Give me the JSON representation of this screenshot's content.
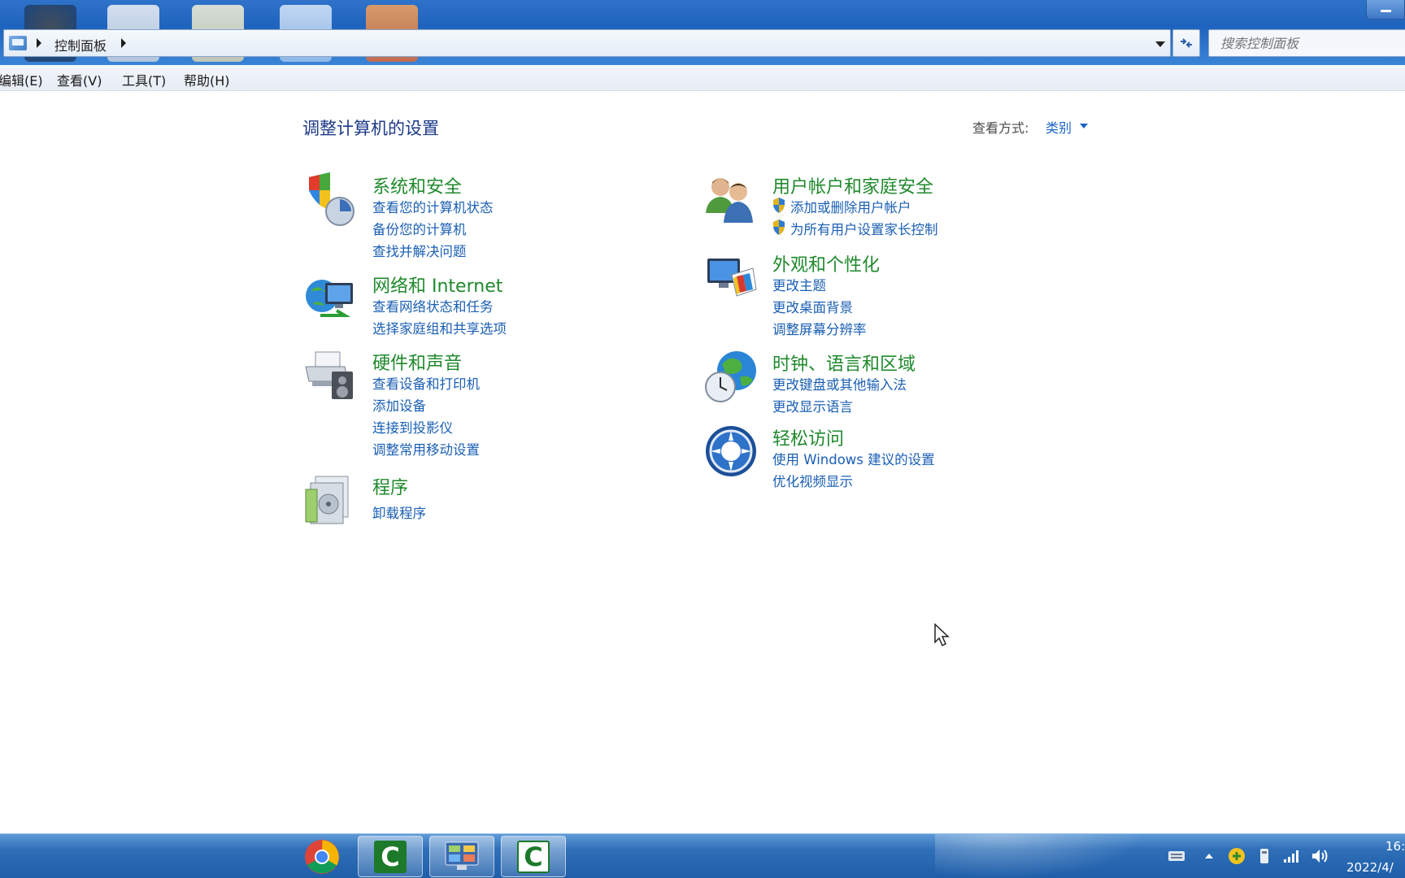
{
  "window": {
    "breadcrumb": "控制面板",
    "search_placeholder": "搜索控制面板"
  },
  "menu": {
    "items": [
      "编辑(E)",
      "查看(V)",
      "工具(T)",
      "帮助(H)"
    ]
  },
  "main": {
    "title": "调整计算机的设置",
    "view_by_label": "查看方式:",
    "view_by_value": "类别",
    "categories": [
      {
        "title": "系统和安全",
        "icon": "system-security-icon",
        "links": [
          "查看您的计算机状态",
          "备份您的计算机",
          "查找并解决问题"
        ]
      },
      {
        "title": "网络和 Internet",
        "icon": "network-icon",
        "links": [
          "查看网络状态和任务",
          "选择家庭组和共享选项"
        ]
      },
      {
        "title": "硬件和声音",
        "icon": "hardware-sound-icon",
        "links": [
          "查看设备和打印机",
          "添加设备",
          "连接到投影仪",
          "调整常用移动设置"
        ]
      },
      {
        "title": "程序",
        "icon": "programs-icon",
        "links": [
          "卸载程序"
        ]
      },
      {
        "title": "用户帐户和家庭安全",
        "icon": "user-accounts-icon",
        "links": [
          "添加或删除用户帐户",
          "为所有用户设置家长控制"
        ]
      },
      {
        "title": "外观和个性化",
        "icon": "appearance-icon",
        "links": [
          "更改主题",
          "更改桌面背景",
          "调整屏幕分辨率"
        ]
      },
      {
        "title": "时钟、语言和区域",
        "icon": "clock-region-icon",
        "links": [
          "更改键盘或其他输入法",
          "更改显示语言"
        ]
      },
      {
        "title": "轻松访问",
        "icon": "ease-of-access-icon",
        "links": [
          "使用 Windows 建议的设置",
          "优化视频显示"
        ]
      }
    ]
  },
  "taskbar": {
    "apps": [
      "chrome-icon",
      "camtasia-icon",
      "control-panel-icon",
      "camtasia-recorder-icon"
    ],
    "clock_time": "16:",
    "clock_date": "2022/4/"
  },
  "colors": {
    "category_title": "#1f8a2c",
    "link": "#1a5fb4",
    "page_title": "#1e3a8a",
    "taskbar": "#1f5ea8"
  }
}
